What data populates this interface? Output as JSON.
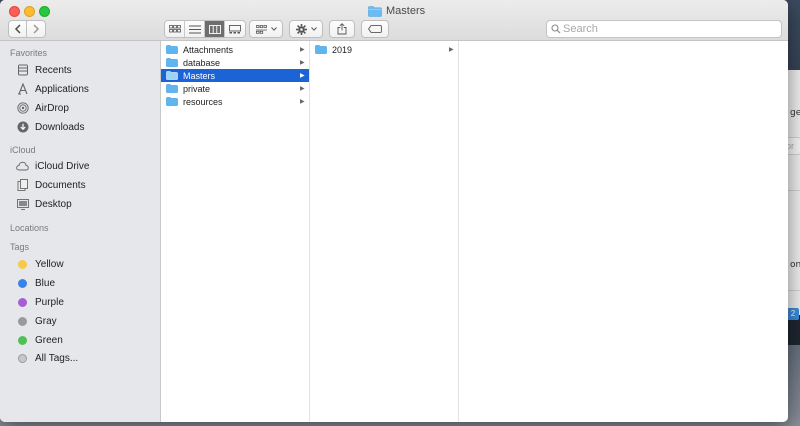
{
  "window": {
    "title": "Masters"
  },
  "toolbar": {
    "view_modes": [
      "icon-view",
      "list-view",
      "column-view",
      "gallery-view"
    ],
    "active_view": "column-view",
    "search_placeholder": "Search"
  },
  "sidebar": {
    "sections": {
      "favorites": "Favorites",
      "icloud": "iCloud",
      "locations": "Locations",
      "tags": "Tags"
    },
    "favorites": [
      {
        "label": "Recents",
        "icon": "clock-icon"
      },
      {
        "label": "Applications",
        "icon": "applications-icon"
      },
      {
        "label": "AirDrop",
        "icon": "airdrop-icon"
      },
      {
        "label": "Downloads",
        "icon": "download-icon"
      }
    ],
    "icloud": [
      {
        "label": "iCloud Drive",
        "icon": "cloud-icon"
      },
      {
        "label": "Documents",
        "icon": "documents-icon"
      },
      {
        "label": "Desktop",
        "icon": "desktop-icon"
      }
    ],
    "tags": [
      {
        "label": "Yellow",
        "color": "#f7c948"
      },
      {
        "label": "Blue",
        "color": "#3b82e8"
      },
      {
        "label": "Purple",
        "color": "#a55fd4"
      },
      {
        "label": "Gray",
        "color": "#9a9a9a"
      },
      {
        "label": "Green",
        "color": "#4fc154"
      },
      {
        "label": "All Tags...",
        "color": "#c8c8c8"
      }
    ]
  },
  "columns": {
    "col1": [
      {
        "label": "Attachments",
        "selected": false
      },
      {
        "label": "database",
        "selected": false
      },
      {
        "label": "Masters",
        "selected": true
      },
      {
        "label": "private",
        "selected": false
      },
      {
        "label": "resources",
        "selected": false
      }
    ],
    "col2": [
      {
        "label": "2019",
        "selected": false
      }
    ]
  },
  "background": {
    "fragment_1": "ge.",
    "fragment_2": "or",
    "fragment_3": "on",
    "badge": "2"
  },
  "colors": {
    "selection": "#1c63d6",
    "folder": "#5eb5f0",
    "sidebar_bg": "#e6e7ea"
  }
}
